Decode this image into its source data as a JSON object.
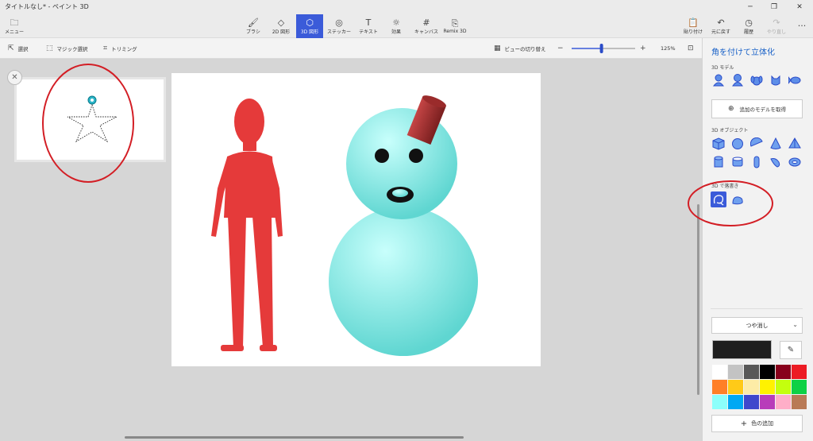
{
  "window": {
    "title": "タイトルなし* - ペイント 3D"
  },
  "menu": {
    "label": "メニュー"
  },
  "tabs": [
    {
      "label": "ブラシ",
      "icon": "brush-icon"
    },
    {
      "label": "2D 図形",
      "icon": "2d-shapes-icon"
    },
    {
      "label": "3D 図形",
      "icon": "3d-shapes-icon"
    },
    {
      "label": "ステッカー",
      "icon": "sticker-icon"
    },
    {
      "label": "テキスト",
      "icon": "text-icon"
    },
    {
      "label": "効果",
      "icon": "effects-icon"
    },
    {
      "label": "キャンバス",
      "icon": "canvas-icon"
    },
    {
      "label": "Remix 3D",
      "icon": "remix3d-icon"
    }
  ],
  "right_actions": [
    {
      "label": "貼り付け",
      "icon": "paste-icon"
    },
    {
      "label": "元に戻す",
      "icon": "undo-icon"
    },
    {
      "label": "履歴",
      "icon": "history-icon"
    },
    {
      "label": "やり直し",
      "icon": "redo-icon"
    }
  ],
  "toolbar": {
    "select": "選択",
    "magic_select": "マジック選択",
    "crop": "トリミング",
    "view_toggle": "ビューの切り替え",
    "zoom_level": "125%",
    "zoom_value": 0.47
  },
  "panel": {
    "title": "角を付けて立体化",
    "models_label": "3D モデル",
    "get_more_label": "追加のモデルを取得",
    "objects_label": "3D オブジェクト",
    "doodle_label": "3D で落書き",
    "finish_label": "つや消し",
    "add_color_label": "色の追加",
    "accent_color": "#1a62c8",
    "selected_color": "#1e1e1e",
    "palette": [
      "#ffffff",
      "#c3c3c3",
      "#585858",
      "#000000",
      "#88001b",
      "#ec1c24",
      "#ff7f27",
      "#ffca18",
      "#fdeca6",
      "#fff200",
      "#c4ff0e",
      "#0ed145",
      "#8cfffb",
      "#00a8f3",
      "#3f48cc",
      "#b83dba",
      "#ffaec8",
      "#b97a56"
    ]
  },
  "canvas": {
    "background": "#ffffff",
    "person_color": "#e53a3a",
    "snowman_color": "#8ef0ec",
    "hat_color": "#a52a2a"
  }
}
